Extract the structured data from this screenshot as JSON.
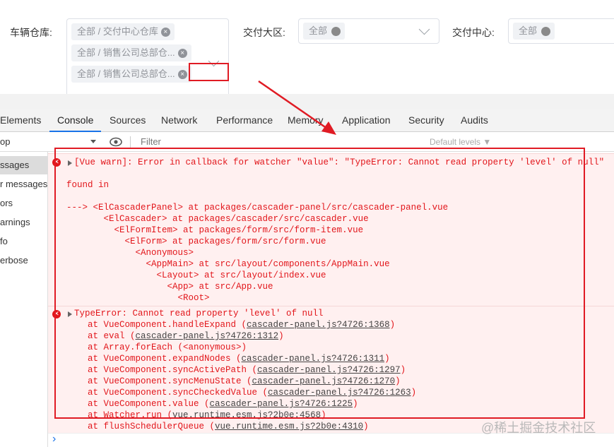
{
  "form": {
    "vehicle_warehouse": {
      "label": "车辆仓库:",
      "tags": [
        "全部 / 交付中心仓库",
        "全部 / 销售公司总部仓...",
        "全部 / 销售公司总部仓..."
      ],
      "tag_close_glyph": "×"
    },
    "delivery_region": {
      "label": "交付大区:",
      "value": "全部"
    },
    "delivery_center": {
      "label": "交付中心:",
      "value": "全部"
    }
  },
  "devtools": {
    "tabs": [
      "Elements",
      "Console",
      "Sources",
      "Network",
      "Performance",
      "Memory",
      "Application",
      "Security",
      "Audits"
    ],
    "active_tab": "Console",
    "toolbar": {
      "context": "op",
      "filter_placeholder": "Filter",
      "levels": "Default levels ▼"
    },
    "sidebar": [
      "ssages",
      "r messages",
      "ors",
      "arnings",
      "fo",
      "erbose"
    ],
    "messages": [
      {
        "lines": [
          "[Vue warn]: Error in callback for watcher \"value\": \"TypeError: Cannot read property 'level' of null\"",
          "",
          "found in",
          "",
          "---> <ElCascaderPanel> at packages/cascader-panel/src/cascader-panel.vue",
          "       <ElCascader> at packages/cascader/src/cascader.vue",
          "         <ElFormItem> at packages/form/src/form-item.vue",
          "           <ElForm> at packages/form/src/form.vue",
          "             <Anonymous>",
          "               <AppMain> at src/layout/components/AppMain.vue",
          "                 <Layout> at src/layout/index.vue",
          "                   <App> at src/App.vue",
          "                     <Root>"
        ]
      },
      {
        "header": "TypeError: Cannot read property 'level' of null",
        "stack": [
          {
            "fn": "    at VueComponent.handleExpand (",
            "src": "cascader-panel.js?4726:1368",
            "end": ")"
          },
          {
            "fn": "    at eval (",
            "src": "cascader-panel.js?4726:1312",
            "end": ")"
          },
          {
            "fn": "    at Array.forEach (<anonymous>)",
            "src": "",
            "end": ""
          },
          {
            "fn": "    at VueComponent.expandNodes (",
            "src": "cascader-panel.js?4726:1311",
            "end": ")"
          },
          {
            "fn": "    at VueComponent.syncActivePath (",
            "src": "cascader-panel.js?4726:1297",
            "end": ")"
          },
          {
            "fn": "    at VueComponent.syncMenuState (",
            "src": "cascader-panel.js?4726:1270",
            "end": ")"
          },
          {
            "fn": "    at VueComponent.syncCheckedValue (",
            "src": "cascader-panel.js?4726:1263",
            "end": ")"
          },
          {
            "fn": "    at VueComponent.value (",
            "src": "cascader-panel.js?4726:1225",
            "end": ")"
          },
          {
            "fn": "    at Watcher.run (",
            "src": "vue.runtime.esm.js?2b0e:4568",
            "end": ")"
          },
          {
            "fn": "    at flushSchedulerQueue (",
            "src": "vue.runtime.esm.js?2b0e:4310",
            "end": ")"
          }
        ]
      }
    ],
    "prompt": "›"
  },
  "watermark": "@稀土掘金技术社区",
  "colors": {
    "annotation_red": "#e01b24",
    "error_red": "#e2161b",
    "error_bg": "#fff0f0",
    "active_tab": "#1a73e8"
  }
}
